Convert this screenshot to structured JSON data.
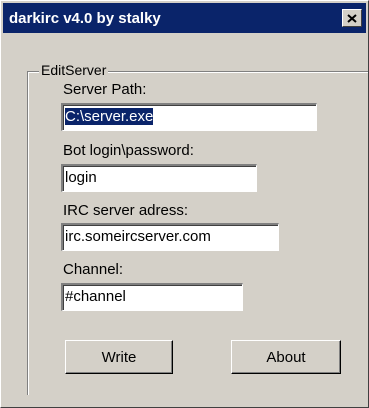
{
  "window": {
    "title": "darkirc v4.0 by stalky"
  },
  "icons": {
    "close": "close-icon"
  },
  "group": {
    "label": "EditServer"
  },
  "fields": {
    "server_path": {
      "label": "Server Path:",
      "value": "C:\\server.exe",
      "selected": true
    },
    "bot_login": {
      "label": "Bot login\\password:",
      "value": "login"
    },
    "irc_server": {
      "label": "IRC server adress:",
      "value": "irc.someircserver.com"
    },
    "channel": {
      "label": "Channel:",
      "value": "#channel"
    }
  },
  "buttons": {
    "write": "Write",
    "about": "About"
  },
  "colors": {
    "titlebar": "#0a246a",
    "face": "#d4d0c8",
    "selection": "#0a246a"
  }
}
